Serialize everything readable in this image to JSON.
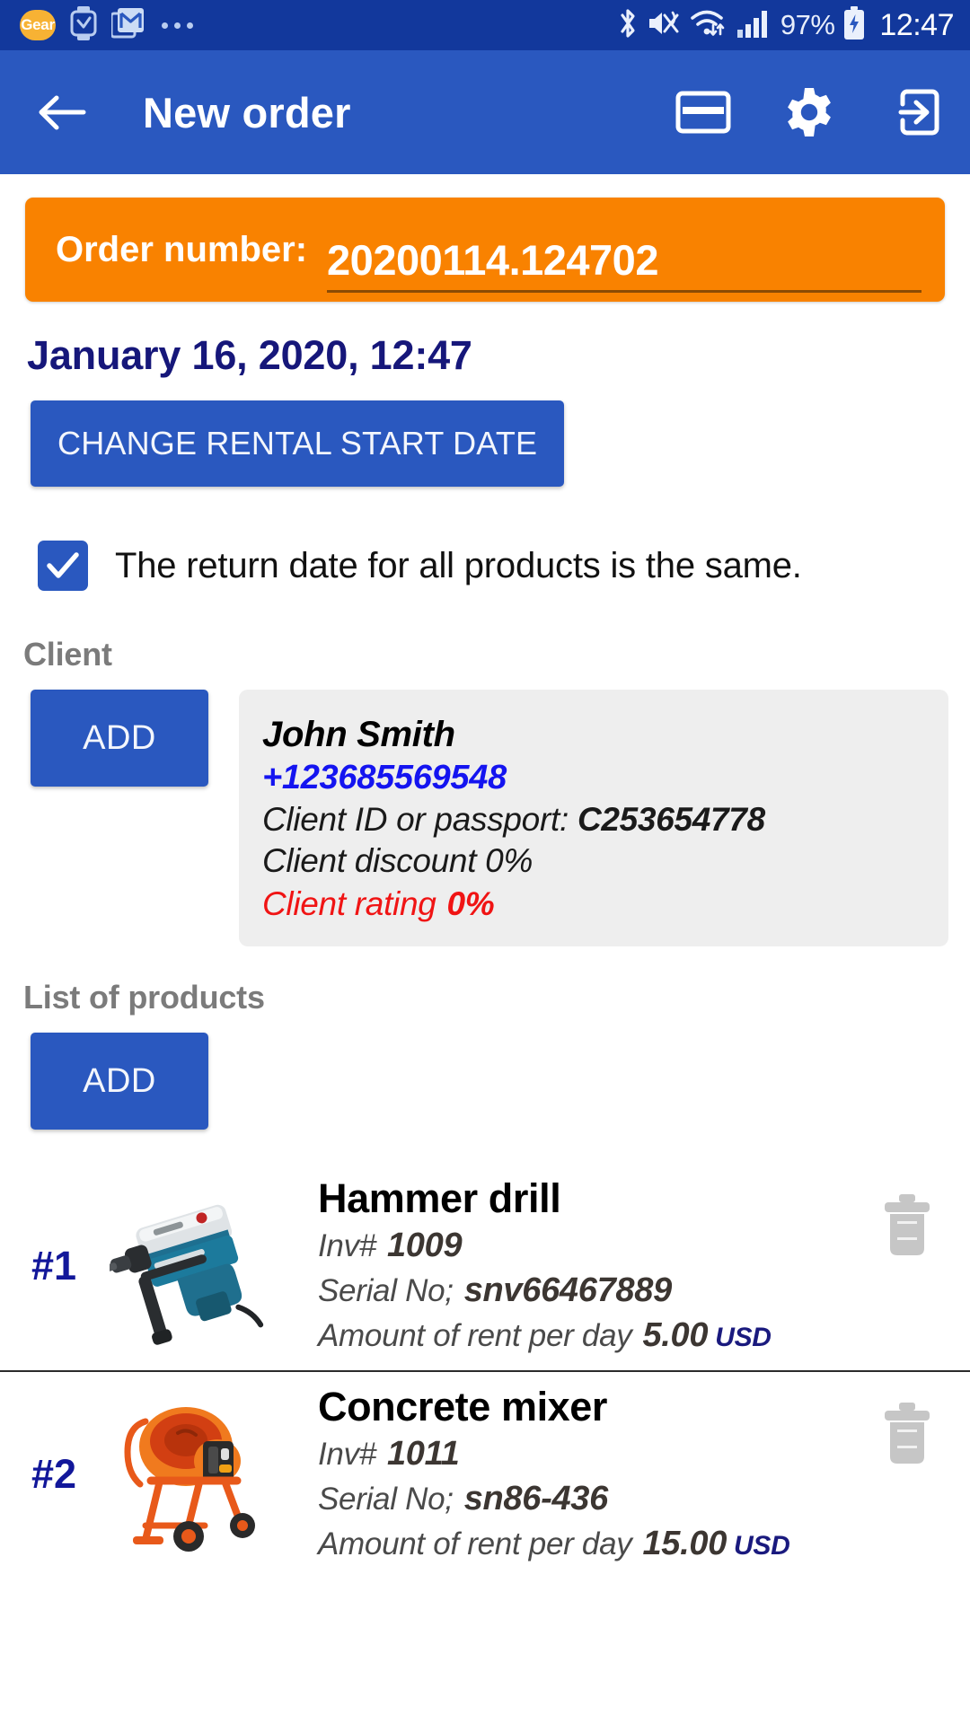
{
  "status_bar": {
    "app_badge": "Gear",
    "left_icons": [
      "gear-app-icon",
      "smartwatch-icon",
      "gmail-icon",
      "more-dots-icon"
    ],
    "right_icons": [
      "bluetooth-icon",
      "mute-vibrate-icon",
      "wifi-icon",
      "cellular-signal-icon",
      "battery-icon"
    ],
    "battery_percent": "97%",
    "clock": "12:47"
  },
  "app_bar": {
    "title": "New order",
    "back_icon": "back-arrow-icon",
    "actions": [
      {
        "name": "payment-card-icon"
      },
      {
        "name": "settings-gear-icon"
      },
      {
        "name": "logout-icon"
      }
    ]
  },
  "order": {
    "label": "Order number:",
    "number": "20200114.124702",
    "accent_color": "#f98200"
  },
  "rental": {
    "start_date": "January 16, 2020, 12:47",
    "change_button": "CHANGE RENTAL START DATE"
  },
  "return_date_option": {
    "checked": true,
    "label": "The return date for all products is the same."
  },
  "client_section": {
    "heading": "Client",
    "add_button": "ADD",
    "client": {
      "name": "John Smith",
      "phone": "+123685569548",
      "id_label": "Client ID or passport:",
      "id_value": "C253654778",
      "discount": "Client discount 0%",
      "rating_label": "Client rating",
      "rating_value": "0%",
      "rating_color": "#f01414"
    }
  },
  "products_section": {
    "heading": "List of products",
    "add_button": "ADD",
    "inv_label": "Inv#",
    "serial_label": "Serial No;",
    "rent_label": "Amount of rent per day",
    "items": [
      {
        "index": "#1",
        "title": "Hammer drill",
        "inv": "1009",
        "serial": "snv66467889",
        "rent": "5.00",
        "currency": "USD",
        "thumb": "hammer-drill-photo"
      },
      {
        "index": "#2",
        "title": "Concrete mixer",
        "inv": "1011",
        "serial": "sn86-436",
        "rent": "15.00",
        "currency": "USD",
        "thumb": "concrete-mixer-photo"
      }
    ]
  }
}
